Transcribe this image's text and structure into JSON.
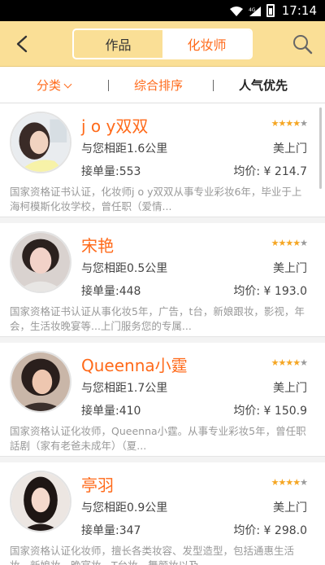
{
  "status": {
    "time": "17:14",
    "network": "4G"
  },
  "header": {
    "tabs": [
      "作品",
      "化妆师"
    ],
    "active_tab": "化妆师",
    "icons": [
      "back-arrow-icon",
      "search-icon"
    ]
  },
  "filters": [
    {
      "label": "分类",
      "color": "#ff6a1a"
    },
    {
      "label": "综合排序",
      "color": "#ff6a1a"
    },
    {
      "label": "人气优先",
      "color": "#222222"
    }
  ],
  "artists": [
    {
      "name": "j o y双双",
      "rating": 4,
      "distance": "与您相距1.6公里",
      "service": "美上门",
      "orders": "接单量:553",
      "price": "均价: ¥ 214.7",
      "desc": "国家资格证书认证，化妆师j o y双双从事专业彩妆6年，毕业于上海柯模斯化妆学校，曾任职（爱情..."
    },
    {
      "name": "宋艳",
      "rating": 4,
      "distance": "与您相距0.5公里",
      "service": "美上门",
      "orders": "接单量:448",
      "price": "均价: ¥ 193.0",
      "desc": "国家资格证书认证从事化妆5年，广告，t台，新娘跟妆，影视，年会，生活妆晚宴等...上门服务您的专属..."
    },
    {
      "name": "Queenna小霆",
      "rating": 4,
      "distance": "与您相距1.7公里",
      "service": "美上门",
      "orders": "接单量:410",
      "price": "均价: ¥ 150.9",
      "desc": "国家资格认证化妆师，Queenna小霆。从事专业彩妆5年，曾任职話剧（家有老爸未成年）（夏..."
    },
    {
      "name": "亭羽",
      "rating": 4,
      "distance": "与您相距0.9公里",
      "service": "美上门",
      "orders": "接单量:347",
      "price": "均价: ¥ 298.0",
      "desc": "国家资格认证化妆师，擅长各类妆容、发型造型，包括通惠生活妆、新娘妆、晚宴妆、T台妆、舞颜妆以及..."
    }
  ]
}
